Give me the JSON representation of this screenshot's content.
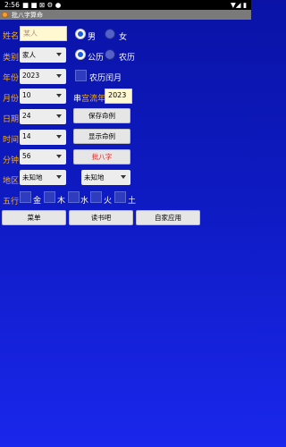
{
  "status": {
    "time": "2:56"
  },
  "title": "批八字算命",
  "form": {
    "name": {
      "label": "姓名",
      "value": "某人"
    },
    "gender": {
      "male": "男",
      "female": "女"
    },
    "category": {
      "label": "类别",
      "value": "家人"
    },
    "calendar": {
      "gregorian": "公历",
      "lunar": "农历"
    },
    "year": {
      "label": "年份",
      "value": "2023"
    },
    "leap_month": "农历闰月",
    "month": {
      "label": "月份",
      "value": "10"
    },
    "palace": {
      "label": "宫流年",
      "prefix": "串",
      "value": "2023"
    },
    "day": {
      "label": "日期",
      "value": "24"
    },
    "hour": {
      "label": "时间",
      "value": "14"
    },
    "minute": {
      "label": "分钟",
      "value": "56"
    },
    "region": {
      "label": "地区",
      "value1": "未知地",
      "value2": "未知地"
    },
    "buttons": {
      "save": "保存命例",
      "show": "显示命例",
      "bazi": "批八字"
    },
    "five_elements": {
      "label": "五行",
      "items": [
        "金",
        "木",
        "水",
        "火",
        "土"
      ]
    }
  },
  "nav": {
    "menu": "菜单",
    "reading": "读书吧",
    "apps": "自家应用"
  }
}
